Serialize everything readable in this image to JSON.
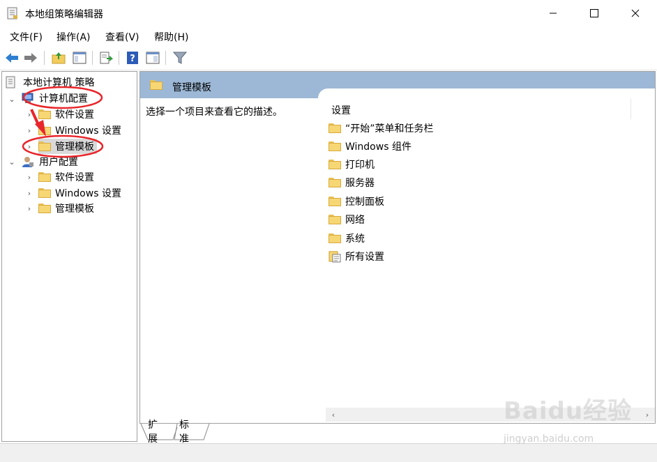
{
  "window": {
    "title": "本地组策略编辑器"
  },
  "menu": [
    "文件(F)",
    "操作(A)",
    "查看(V)",
    "帮助(H)"
  ],
  "toolbar": [
    "back-icon",
    "forward-icon",
    "up-folder-icon",
    "show-hide-tree-icon",
    "export-list-icon",
    "help-icon",
    "properties-icon",
    "filter-icon"
  ],
  "tree": {
    "root": "本地计算机 策略",
    "computer": {
      "label": "计算机配置",
      "children": [
        "软件设置",
        "Windows 设置",
        "管理模板"
      ]
    },
    "user": {
      "label": "用户配置",
      "children": [
        "软件设置",
        "Windows 设置",
        "管理模板"
      ]
    }
  },
  "right": {
    "header_title": "管理模板",
    "description": "选择一个项目来查看它的描述。",
    "column_header": "设置",
    "items": [
      "“开始”菜单和任务栏",
      "Windows 组件",
      "打印机",
      "服务器",
      "控制面板",
      "网络",
      "系统",
      "所有设置"
    ]
  },
  "tabs": [
    "扩展",
    "标准"
  ],
  "watermark": {
    "logo": "Baidu经验",
    "url": "jingyan.baidu.com"
  },
  "colors": {
    "header_blue": "#9cb8d6",
    "folder_yellow": "#f7d774",
    "annotation_red": "#e8262b"
  }
}
